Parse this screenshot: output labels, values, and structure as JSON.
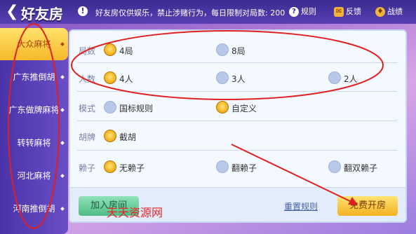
{
  "header": {
    "back_icon": "chevron-left-icon",
    "title": "好友房",
    "notice_icon": "exclamation-icon",
    "notice": "好友房仅供娱乐，禁止涉赌行为，每日限制对局数: 200",
    "rules_label": "规则",
    "feedback_label": "反馈",
    "record_label": "战绩"
  },
  "sidebar": {
    "items": [
      {
        "label": "大众麻将",
        "active": true
      },
      {
        "label": "广东推倒胡",
        "active": false
      },
      {
        "label": "广东做牌麻将",
        "active": false
      },
      {
        "label": "转转麻将",
        "active": false
      },
      {
        "label": "河北麻将",
        "active": false
      },
      {
        "label": "河南推倒胡",
        "active": false
      }
    ]
  },
  "settings": {
    "rounds": {
      "label": "局数",
      "options": [
        {
          "text": "4局",
          "selected": true
        },
        {
          "text": "8局",
          "selected": false
        }
      ]
    },
    "players": {
      "label": "人数",
      "options": [
        {
          "text": "4人",
          "selected": true
        },
        {
          "text": "3人",
          "selected": false
        },
        {
          "text": "2人",
          "selected": false
        }
      ]
    },
    "mode": {
      "label": "模式",
      "options": [
        {
          "text": "国标规则",
          "selected": false
        },
        {
          "text": "自定义",
          "selected": true
        }
      ]
    },
    "hu": {
      "label": "胡牌",
      "options": [
        {
          "text": "截胡",
          "selected": true
        }
      ]
    },
    "wildcard": {
      "label": "赖子",
      "options": [
        {
          "text": "无赖子",
          "selected": true
        },
        {
          "text": "翻赖子",
          "selected": false
        },
        {
          "text": "翻双赖子",
          "selected": false
        }
      ]
    }
  },
  "footer": {
    "join_label": "加入房间",
    "reset_label": "重置规则",
    "create_label": "免费开房"
  },
  "watermark": "天天资源网",
  "colors": {
    "accent_gold": "#f3b121",
    "annotation_red": "#e02020"
  }
}
